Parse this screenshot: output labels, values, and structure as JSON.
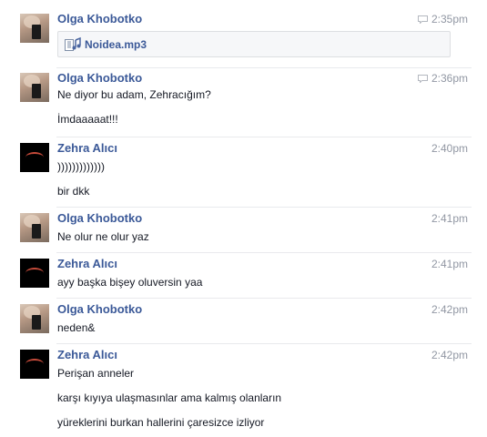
{
  "messages": [
    {
      "author": "Olga Khobotko",
      "avatar": "olga-avatar",
      "time": "2:35pm",
      "seen": true,
      "attachment": {
        "icon": "audio-file-icon",
        "name": "Noidea.mp3"
      },
      "lines": []
    },
    {
      "author": "Olga Khobotko",
      "avatar": "olga-avatar",
      "time": "2:36pm",
      "seen": true,
      "lines": [
        "Ne diyor bu adam, Zehracığım?",
        "İmdaaaaat!!!"
      ]
    },
    {
      "author": "Zehra Alıcı",
      "avatar": "zehra-avatar",
      "time": "2:40pm",
      "seen": false,
      "lines": [
        ")))))))))))))",
        "bir dkk"
      ]
    },
    {
      "author": "Olga Khobotko",
      "avatar": "olga-avatar",
      "time": "2:41pm",
      "seen": false,
      "lines": [
        "Ne olur ne olur yaz"
      ]
    },
    {
      "author": "Zehra Alıcı",
      "avatar": "zehra-avatar",
      "time": "2:41pm",
      "seen": false,
      "lines": [
        "ayy başka bişey oluversin yaa"
      ]
    },
    {
      "author": "Olga Khobotko",
      "avatar": "olga-avatar",
      "time": "2:42pm",
      "seen": false,
      "lines": [
        "neden&"
      ]
    },
    {
      "author": "Zehra Alıcı",
      "avatar": "zehra-avatar",
      "time": "2:42pm",
      "seen": false,
      "lines": [
        "Perişan anneler",
        "karşı kıyıya ulaşmasınlar ama kalmış olanların",
        "yüreklerini burkan hallerini çaresizce izliyor"
      ]
    }
  ],
  "colors": {
    "author": "#3b5998",
    "time": "#9197a3",
    "text": "#141823",
    "divider": "#e9eaed"
  }
}
